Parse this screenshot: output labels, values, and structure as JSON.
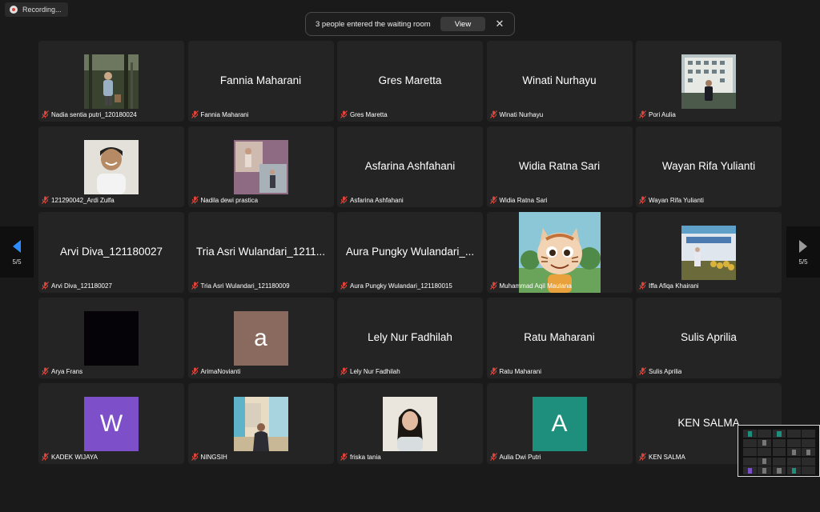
{
  "recording": {
    "label": "Recording..."
  },
  "notification": {
    "message": "3 people entered the waiting room",
    "view_label": "View",
    "close_glyph": "✕"
  },
  "pagination": {
    "left": "5/5",
    "right": "5/5"
  },
  "colors": {
    "background": "#1a1a1a",
    "tile": "#242424",
    "mute_red": "#e0443a"
  },
  "participants": [
    {
      "name": "Nadia sentia putri_120180024",
      "display": "photo",
      "icon": "person-forest-photo"
    },
    {
      "name": "Fannia Maharani",
      "display": "name",
      "big_name": "Fannia Maharani"
    },
    {
      "name": "Gres Maretta",
      "display": "name",
      "big_name": "Gres Maretta"
    },
    {
      "name": "Winati Nurhayu",
      "display": "name",
      "big_name": "Winati Nurhayu"
    },
    {
      "name": "Pori Aulia",
      "display": "photo",
      "icon": "building-photo"
    },
    {
      "name": "121290042_Ardi Zulfa",
      "display": "photo",
      "icon": "smiling-man-photo"
    },
    {
      "name": "Nadila dewi prastica",
      "display": "photo",
      "icon": "collage-photo"
    },
    {
      "name": "Asfarina Ashfahani",
      "display": "name",
      "big_name": "Asfarina Ashfahani"
    },
    {
      "name": "Widia Ratna Sari",
      "display": "name",
      "big_name": "Widia Ratna Sari"
    },
    {
      "name": "Wayan Rifa Yulianti",
      "display": "name",
      "big_name": "Wayan Rifa Yulianti"
    },
    {
      "name": "Arvi Diva_121180027",
      "display": "name",
      "big_name": "Arvi Diva_121180027"
    },
    {
      "name": "Tria Asri Wulandari_121180009",
      "display": "name",
      "big_name": "Tria Asri Wulandari_1211..."
    },
    {
      "name": "Aura Pungky Wulandari_121180015",
      "display": "name",
      "big_name": "Aura Pungky Wulandari_..."
    },
    {
      "name": "Muhammad Aqil Maulana",
      "display": "video",
      "icon": "cartoon-character-video"
    },
    {
      "name": "Iffa Afiqa Khairani",
      "display": "photo",
      "icon": "event-stage-photo"
    },
    {
      "name": "Arya Frans",
      "display": "photo",
      "icon": "black-photo"
    },
    {
      "name": "ArimaNovianti",
      "display": "letter",
      "letter": "a",
      "color": "#8a6a5e"
    },
    {
      "name": "Lely Nur Fadhilah",
      "display": "name",
      "big_name": "Lely Nur Fadhilah"
    },
    {
      "name": "Ratu Maharani",
      "display": "name",
      "big_name": "Ratu Maharani"
    },
    {
      "name": "Sulis Aprilia",
      "display": "name",
      "big_name": "Sulis Aprilia"
    },
    {
      "name": "KADEK WIJAYA",
      "display": "letter",
      "letter": "W",
      "color": "#7d4fc9"
    },
    {
      "name": "NINGSIH",
      "display": "photo",
      "icon": "colorful-wall-photo"
    },
    {
      "name": "friska tania",
      "display": "photo",
      "icon": "girl-portrait-photo"
    },
    {
      "name": "Aulia Dwi Putri",
      "display": "letter",
      "letter": "A",
      "color": "#1d8f7c"
    },
    {
      "name": "KEN SALMA",
      "display": "name",
      "big_name": "KEN SALMA"
    }
  ]
}
